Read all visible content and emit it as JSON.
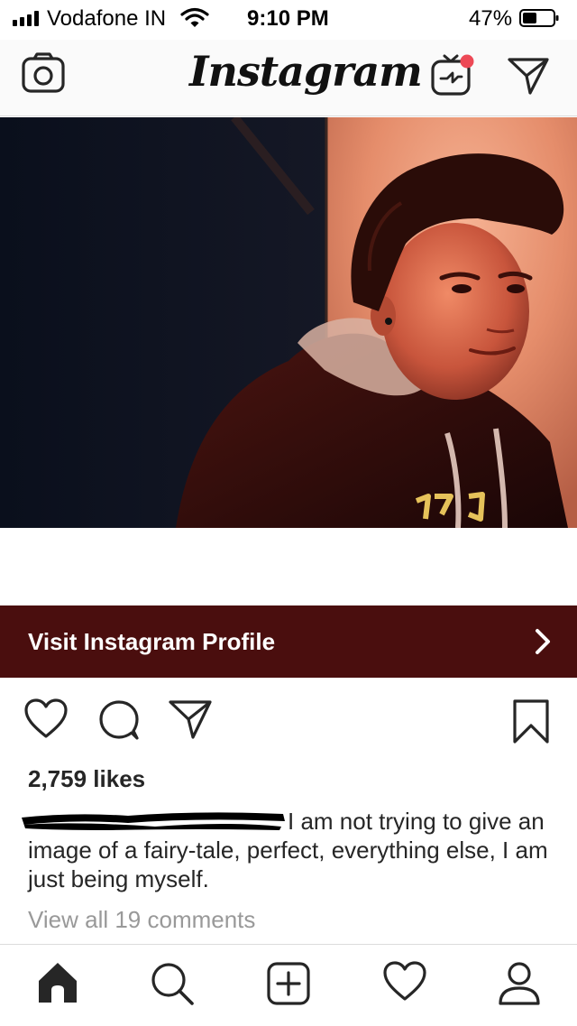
{
  "status_bar": {
    "carrier": "Vodafone IN",
    "time": "9:10 PM",
    "battery_percent": "47%",
    "battery_level": 0.47
  },
  "header": {
    "logo_text": "Instagram",
    "icons": [
      "camera-icon",
      "igtv-icon",
      "direct-message-icon"
    ],
    "igtv_badge_color": "#ed4956"
  },
  "post": {
    "visit_profile_label": "Visit Instagram Profile",
    "visit_bar_color": "#4a0e0e",
    "likes": "2,759 likes",
    "caption_text": "I am not trying to give an image of a fairy-tale, perfect, everything else, I am just being myself.",
    "view_comments": "View all 19 comments",
    "actions": [
      "heart-icon",
      "comment-icon",
      "share-icon",
      "bookmark-icon"
    ]
  },
  "tab_bar": {
    "items": [
      "home-icon",
      "search-icon",
      "new-post-icon",
      "activity-icon",
      "profile-icon"
    ]
  }
}
